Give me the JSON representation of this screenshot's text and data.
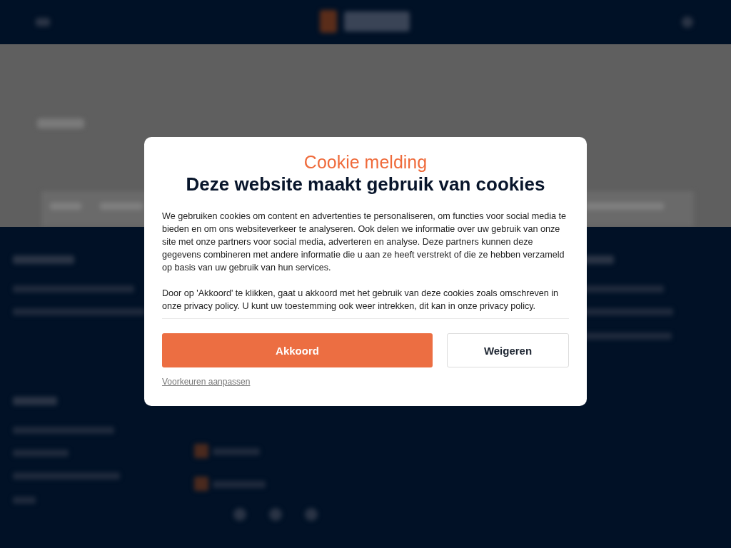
{
  "cookie_dialog": {
    "title": "Cookie melding",
    "heading": "Deze website maakt gebruik van cookies",
    "paragraphs": [
      "We gebruiken cookies om content en advertenties te personaliseren, om functies voor social media te bieden en om ons websiteverkeer te analyseren. Ook delen we informatie over uw gebruik van onze site met onze partners voor social media, adverteren en analyse. Deze partners kunnen deze gegevens combineren met andere informatie die u aan ze heeft verstrekt of die ze hebben verzameld op basis van uw gebruik van hun services.",
      "Door op 'Akkoord' te klikken, gaat u akkoord met het gebruik van deze cookies zoals omschreven in onze privacy policy. U kunt uw toestemming ook weer intrekken, dit kan in onze privacy policy."
    ],
    "buttons": [
      {
        "label": "Akkoord",
        "kind": "primary"
      },
      {
        "label": "Weigeren",
        "kind": "secondary"
      }
    ],
    "link": "Voorkeuren aanpassen"
  }
}
